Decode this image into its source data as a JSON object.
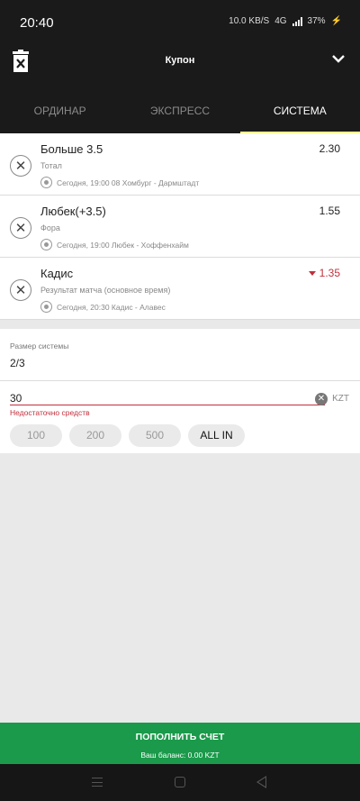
{
  "statusbar": {
    "time": "20:40",
    "speed": "10.0 KB/S",
    "network": "4G",
    "battery": "37%"
  },
  "header": {
    "title": "Купон"
  },
  "tabs": [
    {
      "label": "ОРДИНАР",
      "active": false
    },
    {
      "label": "ЭКСПРЕСС",
      "active": false
    },
    {
      "label": "СИСТЕМА",
      "active": true
    }
  ],
  "bets": [
    {
      "name": "Больше 3.5",
      "odds": "2.30",
      "type": "Тотал",
      "event": "Сегодня, 19:00 08 Хомбург - Дармштадт"
    },
    {
      "name": "Любек(+3.5)",
      "odds": "1.55",
      "type": "Фора",
      "event": "Сегодня, 19:00 Любек - Хоффенхайм"
    },
    {
      "name": "Кадис",
      "odds": "1.35",
      "type": "Результат матча (основное время)",
      "event": "Сегодня, 20:30 Кадис - Алавес",
      "odds_trend": "down"
    }
  ],
  "system": {
    "size_label": "Размер системы",
    "size_value": "2/3",
    "stake_value": "30",
    "currency": "KZT",
    "error": "Недостаточно средств",
    "quick_stakes": [
      "100",
      "200",
      "500",
      "ALL IN"
    ]
  },
  "topup": {
    "label": "ПОПОЛНИТЬ СЧЕТ",
    "balance": "Ваш баланс: 0.00 KZT"
  },
  "colors": {
    "accent_green": "#1a9a4a",
    "error_red": "#c0303c",
    "tab_underline": "#f2f291",
    "header_bg": "#1a1a1a"
  },
  "icons": [
    "trash-x-icon",
    "chevron-down-icon",
    "close-icon",
    "soccer-ball-icon",
    "clear-icon",
    "menu-icon",
    "home-icon",
    "back-icon"
  ]
}
